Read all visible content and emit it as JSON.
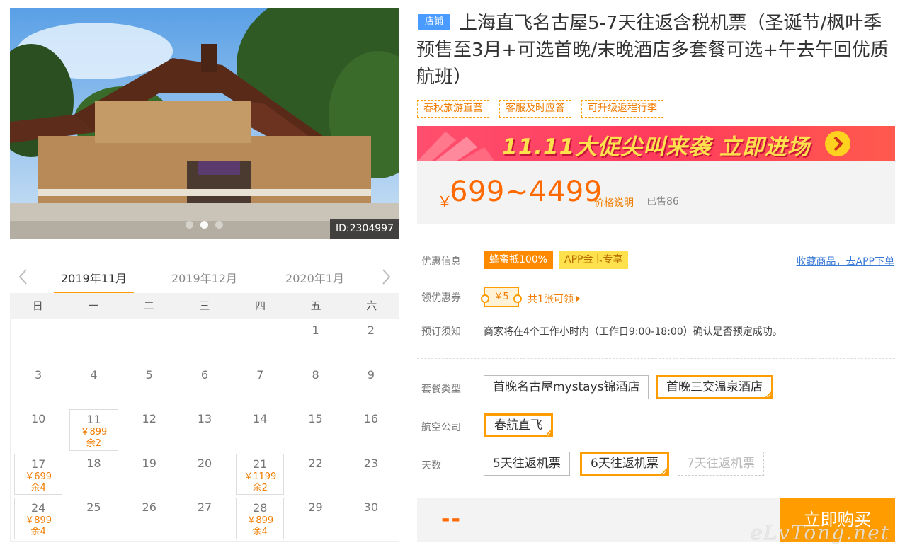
{
  "product": {
    "shop_badge": "店铺",
    "title": "上海直飞名古屋5-7天往返含税机票（圣诞节/枫叶季预售至3月+可选首晚/末晚酒店多套餐可选+午去午回优质航班）",
    "image_id": "ID:2304997",
    "tags": [
      "春秋旅游直营",
      "客服及时应答",
      "可升级返程行李"
    ]
  },
  "promo": {
    "text": "11.11大促尖叫来袭  立即进场"
  },
  "price": {
    "currency": "￥",
    "range": "699~4499",
    "note": "价格说明",
    "sold": "已售86"
  },
  "info": {
    "discount_label": "优惠信息",
    "discount_badge": "蜂蜜抵100%",
    "app_badge": "APP金卡专享",
    "fav_link": "收藏商品，去APP下单",
    "coupon_label": "领优惠券",
    "coupon_value": "￥5",
    "coupon_more": "共1张可领",
    "notice_label": "预订须知",
    "notice_text": "商家将在4个工作小时内（工作日9:00-18:00）确认是否预定成功。"
  },
  "options": {
    "package_label": "套餐类型",
    "packages": [
      {
        "label": "首晚名古屋mystays锦酒店",
        "selected": false
      },
      {
        "label": "首晚三交温泉酒店",
        "selected": true
      }
    ],
    "airline_label": "航空公司",
    "airlines": [
      {
        "label": "春航直飞",
        "selected": true
      }
    ],
    "days_label": "天数",
    "days": [
      {
        "label": "5天往返机票",
        "selected": false
      },
      {
        "label": "6天往返机票",
        "selected": true
      },
      {
        "label": "7天往返机票",
        "selected": false,
        "disabled": true
      }
    ]
  },
  "buy": {
    "total": "--",
    "button": "立即购买",
    "watermark": "eLvTong.net"
  },
  "calendar": {
    "months": [
      "2019年11月",
      "2019年12月",
      "2020年1月"
    ],
    "active_month": 0,
    "weekdays": [
      "日",
      "一",
      "二",
      "三",
      "四",
      "五",
      "六"
    ],
    "weeks": [
      [
        null,
        null,
        null,
        null,
        null,
        {
          "day": "1"
        },
        {
          "day": "2"
        }
      ],
      [
        {
          "day": "3"
        },
        {
          "day": "4"
        },
        {
          "day": "5"
        },
        {
          "day": "6"
        },
        {
          "day": "7"
        },
        {
          "day": "8"
        },
        {
          "day": "9"
        }
      ],
      [
        {
          "day": "10"
        },
        {
          "day": "11",
          "price": "￥899",
          "stock": "余2"
        },
        {
          "day": "12"
        },
        {
          "day": "13"
        },
        {
          "day": "14"
        },
        {
          "day": "15"
        },
        {
          "day": "16"
        }
      ],
      [
        {
          "day": "17",
          "price": "￥699",
          "stock": "余4"
        },
        {
          "day": "18"
        },
        {
          "day": "19"
        },
        {
          "day": "20"
        },
        {
          "day": "21",
          "price": "￥1199",
          "stock": "余2"
        },
        {
          "day": "22"
        },
        {
          "day": "23"
        }
      ],
      [
        {
          "day": "24",
          "price": "￥899",
          "stock": "余4"
        },
        {
          "day": "25"
        },
        {
          "day": "26"
        },
        {
          "day": "27"
        },
        {
          "day": "28",
          "price": "￥899",
          "stock": "余4"
        },
        {
          "day": "29"
        },
        {
          "day": "30"
        }
      ]
    ]
  },
  "colors": {
    "accent": "#ff9d00",
    "price": "#ff6a00",
    "link": "#3a7ad7",
    "shop_badge": "#4a9bff"
  }
}
